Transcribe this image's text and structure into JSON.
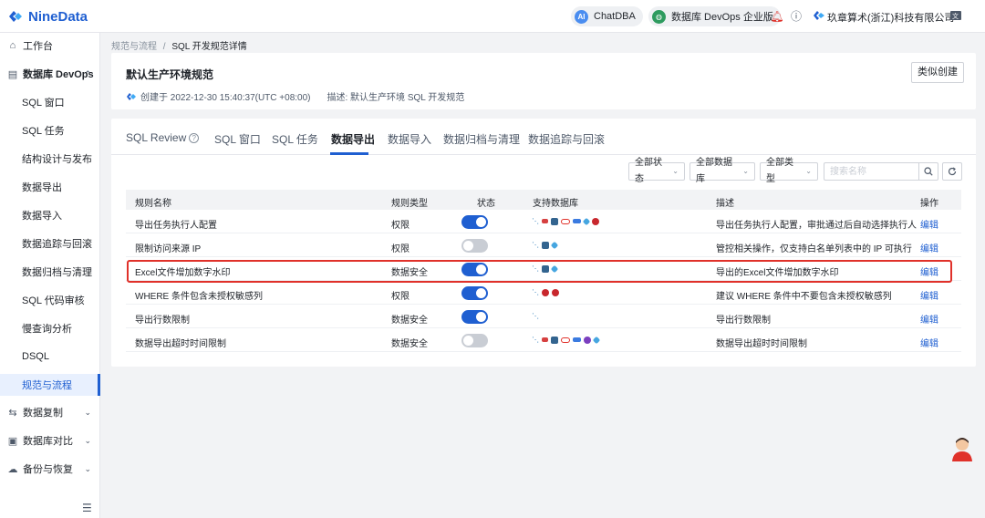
{
  "app": {
    "logo_text": "NineData"
  },
  "topbar": {
    "chatdba": "ChatDBA",
    "devops": "数据库 DevOps 企业版",
    "company": "玖章算术(浙江)科技有限公司"
  },
  "sidebar": {
    "items": [
      {
        "label": "工作台",
        "icon": "home-icon"
      },
      {
        "label": "数据库 DevOps",
        "icon": "database-icon"
      },
      {
        "label": "SQL 窗口"
      },
      {
        "label": "SQL 任务"
      },
      {
        "label": "结构设计与发布"
      },
      {
        "label": "数据导出"
      },
      {
        "label": "数据导入"
      },
      {
        "label": "数据追踪与回滚"
      },
      {
        "label": "数据归档与清理"
      },
      {
        "label": "SQL 代码审核"
      },
      {
        "label": "慢查询分析"
      },
      {
        "label": "DSQL"
      },
      {
        "label": "规范与流程"
      },
      {
        "label": "数据复制",
        "icon": "replicate-icon"
      },
      {
        "label": "数据库对比",
        "icon": "compare-icon"
      },
      {
        "label": "备份与恢复",
        "icon": "backup-icon"
      }
    ]
  },
  "breadcrumb": {
    "parent": "规范与流程",
    "sep": "/",
    "current": "SQL 开发规范详情"
  },
  "header": {
    "title": "默认生产环境规范",
    "created": "创建于 2022-12-30 15:40:37(UTC +08:00)",
    "desc": "描述: 默认生产环境 SQL 开发规范",
    "clone_label": "类似创建"
  },
  "tabs": [
    {
      "label": "SQL Review"
    },
    {
      "label": "SQL 窗口"
    },
    {
      "label": "SQL 任务"
    },
    {
      "label": "数据导出"
    },
    {
      "label": "数据导入"
    },
    {
      "label": "数据归档与清理"
    },
    {
      "label": "数据追踪与回滚"
    }
  ],
  "filters": {
    "status": "全部状态",
    "database": "全部数据库",
    "type": "全部类型",
    "search_placeholder": "搜索名称"
  },
  "table": {
    "headers": [
      "规则名称",
      "规则类型",
      "状态",
      "支持数据库",
      "描述",
      "操作"
    ],
    "rows": [
      {
        "name": "导出任务执行人配置",
        "type": "权限",
        "enabled": true,
        "desc": "导出任务执行人配置，审批通过后自动选择执行人",
        "action": "编辑"
      },
      {
        "name": "限制访问来源 IP",
        "type": "权限",
        "enabled": false,
        "desc": "管控相关操作，仅支持白名单列表中的 IP 可执行",
        "action": "编辑"
      },
      {
        "name": "Excel文件增加数字水印",
        "type": "数据安全",
        "enabled": true,
        "desc": "导出的Excel文件增加数字水印",
        "action": "编辑"
      },
      {
        "name": "WHERE 条件包含未授权敏感列",
        "type": "权限",
        "enabled": true,
        "desc": "建议 WHERE 条件中不要包含未授权敏感列",
        "action": "编辑"
      },
      {
        "name": "导出行数限制",
        "type": "数据安全",
        "enabled": true,
        "desc": "导出行数限制",
        "action": "编辑"
      },
      {
        "name": "数据导出超时时间限制",
        "type": "数据安全",
        "enabled": false,
        "desc": "数据导出超时时间限制",
        "action": "编辑"
      }
    ]
  },
  "colors": {
    "accent": "#1f5fd1",
    "highlight": "#e0312a"
  }
}
